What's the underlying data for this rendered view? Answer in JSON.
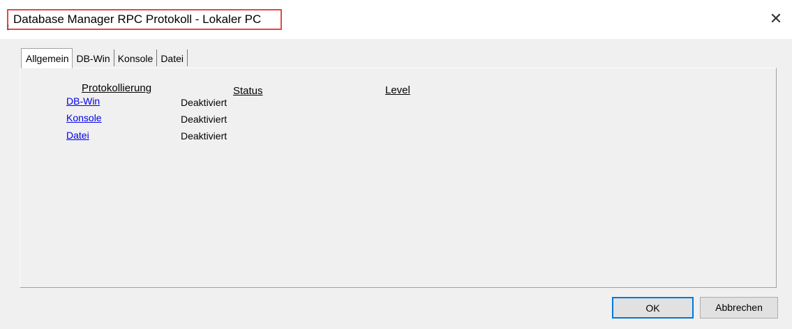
{
  "window": {
    "title": "Database Manager RPC Protokoll - Lokaler PC",
    "close_glyph": "✕",
    "cursor_glyph": "↕"
  },
  "tabs": [
    {
      "label": "Allgemein",
      "active": true
    },
    {
      "label": "DB-Win",
      "active": false
    },
    {
      "label": "Konsole",
      "active": false
    },
    {
      "label": "Datei",
      "active": false
    }
  ],
  "general": {
    "headers": {
      "protokollierung": "Protokollierung",
      "status": "Status",
      "level": "Level"
    },
    "rows": [
      {
        "name": "DB-Win",
        "status": "Deaktiviert"
      },
      {
        "name": "Konsole",
        "status": "Deaktiviert"
      },
      {
        "name": "Datei",
        "status": "Deaktiviert"
      }
    ]
  },
  "buttons": {
    "ok": "OK",
    "cancel": "Abbrechen"
  },
  "colors": {
    "highlight_border": "#e84545",
    "link": "#0000ee",
    "default_button_border": "#0078d7"
  }
}
